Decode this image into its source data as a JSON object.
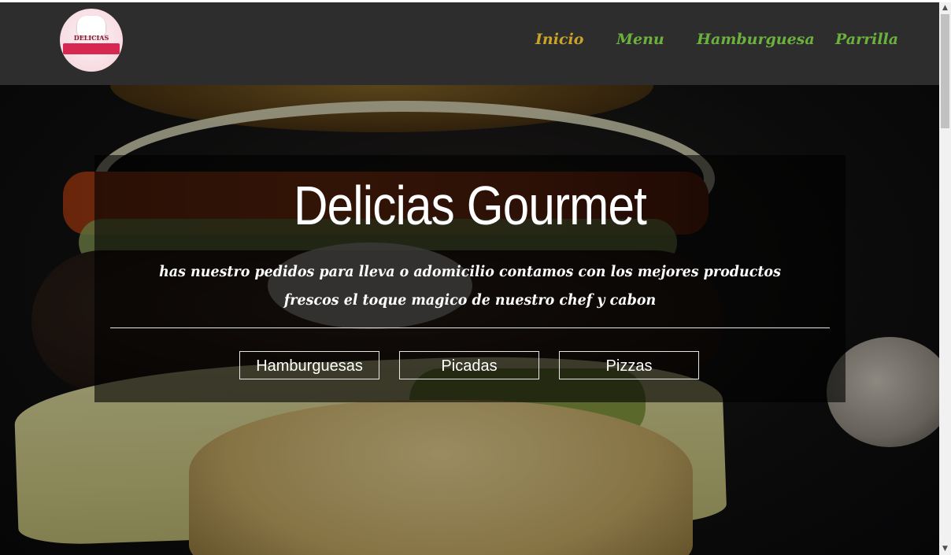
{
  "brand": {
    "logo_text": "DELICIAS"
  },
  "nav": {
    "items": [
      {
        "label": "Inicio",
        "active": true
      },
      {
        "label": "Menu",
        "active": false
      },
      {
        "label": "Hamburguesa",
        "active": false
      },
      {
        "label": "Parrilla",
        "active": false
      }
    ]
  },
  "hero": {
    "title": "Delicias Gourmet",
    "tagline": "has nuestro pedidos para lleva o adomicilio contamos con los mejores productos frescos el toque magico de nuestro chef y cabon",
    "buttons": [
      {
        "label": "Hamburguesas"
      },
      {
        "label": "Picadas"
      },
      {
        "label": "Pizzas"
      }
    ]
  },
  "colors": {
    "header_bg": "#2d2d2d",
    "nav_active": "#c9a32a",
    "nav_default": "#6cb13e",
    "overlay": "rgba(0,0,0,0.6)"
  }
}
